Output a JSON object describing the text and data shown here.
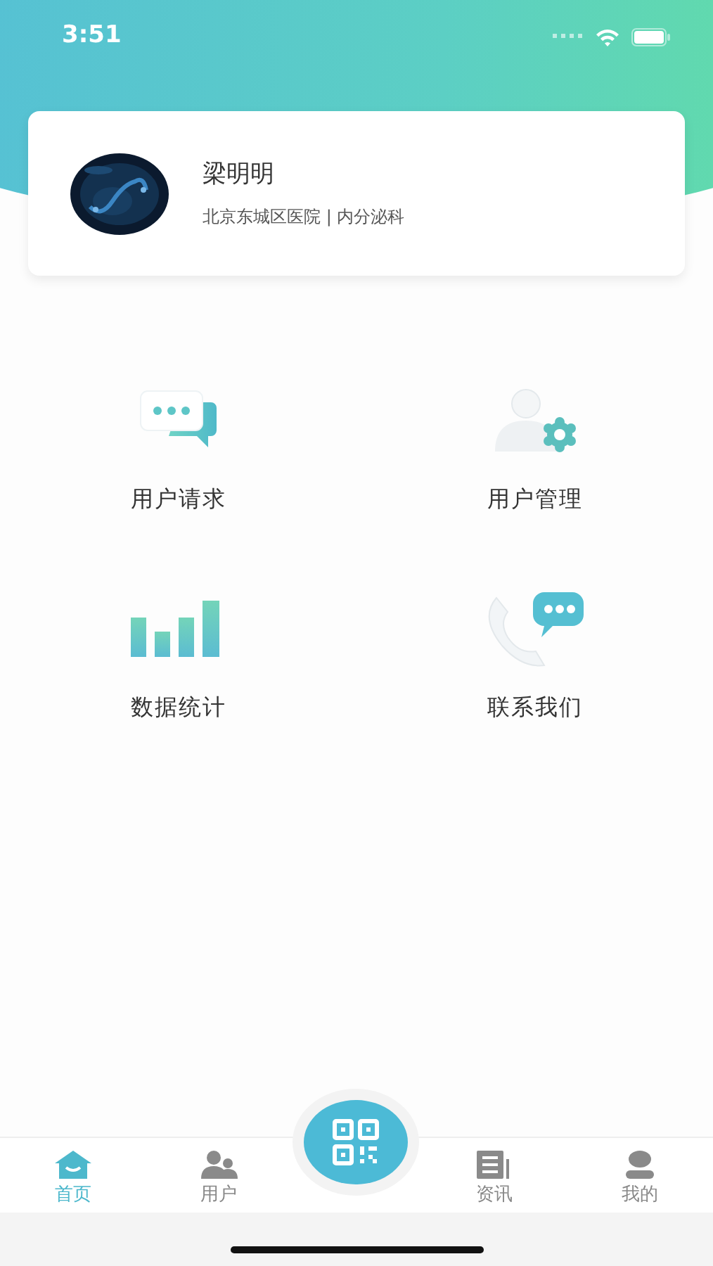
{
  "status_bar": {
    "time": "3:51"
  },
  "profile": {
    "name": "梁明明",
    "affiliation": "北京东城区医院 | 内分泌科"
  },
  "menu": [
    {
      "label": "用户请求"
    },
    {
      "label": "用户管理"
    },
    {
      "label": "数据统计"
    },
    {
      "label": "联系我们"
    }
  ],
  "tab_bar": [
    {
      "kind": "tab",
      "label": "首页",
      "selected": true
    },
    {
      "kind": "tab",
      "label": "用户",
      "selected": false
    },
    {
      "kind": "scan"
    },
    {
      "kind": "tab",
      "label": "资讯",
      "selected": false
    },
    {
      "kind": "tab",
      "label": "我的",
      "selected": false
    }
  ]
}
